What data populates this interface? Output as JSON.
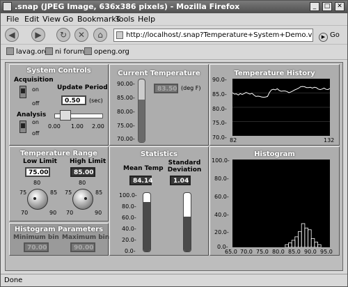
{
  "window": {
    "title": ".snap (JPEG Image, 636x386 pixels) - Mozilla Firefox"
  },
  "menu": [
    "File",
    "Edit",
    "View",
    "Go",
    "Bookmarks",
    "Tools",
    "Help"
  ],
  "address": {
    "url": "http://localhost/.snap?Temperature+System+Demo.vi",
    "go_label": "Go"
  },
  "bookmarks": [
    "lavag.org",
    "ni forums",
    "openg.org"
  ],
  "status": "Done",
  "vi": {
    "system_controls": {
      "title": "System Controls",
      "acquisition_label": "Acquisition",
      "analysis_label": "Analysis",
      "on": "on",
      "off": "off",
      "update_period_label": "Update Period",
      "update_period_value": "0.50",
      "update_period_unit": "(sec)",
      "slider_ticks": [
        "0.00",
        "1.00",
        "2.00"
      ]
    },
    "current_temp": {
      "title": "Current Temperature",
      "value": "83.50",
      "unit": "(deg F)",
      "scale": [
        "90.00-",
        "85.00-",
        "80.00-",
        "75.00-",
        "70.00-"
      ],
      "level": 0.675
    },
    "temp_history": {
      "title": "Temperature History",
      "y_ticks": [
        "90.0-",
        "85.0-",
        "80.0-",
        "75.0-",
        "70.0-"
      ],
      "x_min": "82",
      "x_max": "132"
    },
    "temp_range": {
      "title": "Temperature Range",
      "low_label": "Low Limit",
      "high_label": "High Limit",
      "low_value": "75.00",
      "high_value": "85.00",
      "knob_ticks": [
        "80",
        "75",
        "85",
        "70",
        "90"
      ]
    },
    "statistics": {
      "title": "Statistics",
      "mean_label": "Mean Temp",
      "std_label": "Standard Deviation",
      "mean_value": "84.14",
      "std_value": "1.04",
      "scale": [
        "100.0-",
        "80.0-",
        "60.0-",
        "40.0-",
        "20.0-",
        "0.0-"
      ],
      "mean_level": 0.84,
      "std_level": 0.6
    },
    "histogram": {
      "title": "Histogram",
      "y_ticks": [
        "100.0-",
        "80.0-",
        "60.0-",
        "40.0-",
        "20.0-",
        "0.0-"
      ],
      "x_ticks": [
        "65.0",
        "70.0",
        "75.0",
        "80.0",
        "85.0",
        "90.0",
        "95.0"
      ]
    },
    "histogram_params": {
      "title": "Histogram Parameters",
      "min_label": "Minimum bin",
      "max_label": "Maximum bin",
      "min_value": "70.00",
      "max_value": "90.00"
    }
  },
  "chart_data": [
    {
      "type": "line",
      "title": "Temperature History",
      "xlim": [
        82,
        132
      ],
      "ylim": [
        70,
        90
      ],
      "series": [
        {
          "values": [
            85.1,
            84.6,
            84.7,
            84.3,
            84.8,
            84.5,
            84.8,
            85.2,
            84.9,
            84.6,
            84.9,
            84.3,
            83.8,
            83.9,
            83.8,
            83.6,
            83.5,
            83.6,
            83.8,
            85.2,
            86.1,
            86.3,
            86.1,
            86.5,
            85.9,
            85.6,
            85.7,
            85.7,
            85.5,
            85.1,
            85.4,
            85.7,
            86.1,
            86.4,
            86.7,
            87.2,
            87.3,
            87.2,
            86.9,
            86.9,
            87.0,
            86.7,
            87.0,
            86.9,
            86.4,
            86.2,
            86.4,
            86.7,
            86.3,
            86.2,
            86.6
          ]
        }
      ]
    },
    {
      "type": "bar",
      "title": "Histogram",
      "xlim": [
        65,
        95
      ],
      "ylim": [
        0,
        100
      ],
      "bin_start": 81.25,
      "bin_width": 0.5,
      "values": [
        3,
        0,
        5,
        0,
        8,
        0,
        12,
        0,
        18,
        0,
        27,
        0,
        22,
        0,
        20,
        0,
        10,
        0,
        6,
        0,
        3
      ]
    }
  ]
}
